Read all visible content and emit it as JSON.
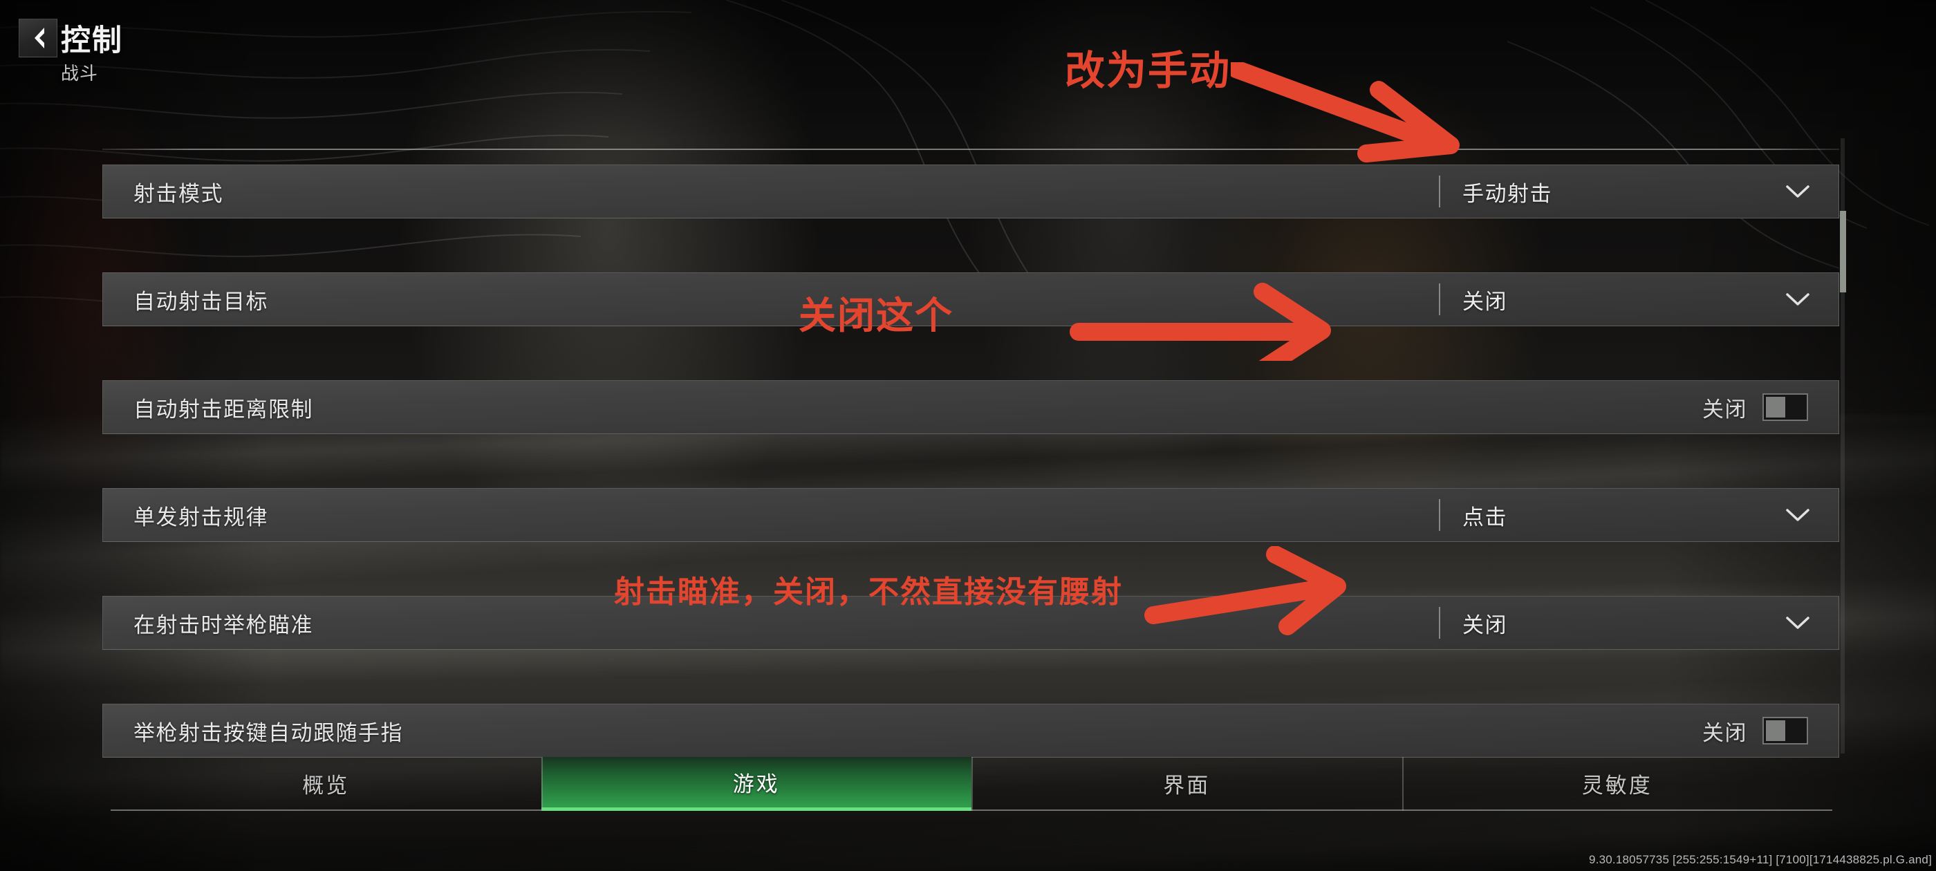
{
  "header": {
    "back_icon": "chevron-left-icon",
    "title": "控制",
    "subtitle": "战斗"
  },
  "settings": {
    "rows": [
      {
        "label": "射击模式",
        "control": "dropdown",
        "value": "手动射击",
        "icon": "chevron-down-icon"
      },
      {
        "label": "自动射击目标",
        "control": "dropdown",
        "value": "关闭",
        "icon": "chevron-down-icon"
      },
      {
        "label": "自动射击距离限制",
        "control": "toggle",
        "value": "关闭",
        "state": "off"
      },
      {
        "label": "单发射击规律",
        "control": "dropdown",
        "value": "点击",
        "icon": "chevron-down-icon"
      },
      {
        "label": "在射击时举枪瞄准",
        "control": "dropdown",
        "value": "关闭",
        "icon": "chevron-down-icon"
      },
      {
        "label": "举枪射击按键自动跟随手指",
        "control": "toggle",
        "value": "关闭",
        "state": "off"
      }
    ]
  },
  "tabs": [
    {
      "label": "概览",
      "active": false
    },
    {
      "label": "游戏",
      "active": true
    },
    {
      "label": "界面",
      "active": false
    },
    {
      "label": "灵敏度",
      "active": false
    }
  ],
  "annotations": [
    {
      "text": "改为手动"
    },
    {
      "text": "关闭这个"
    },
    {
      "text": "射击瞄准，关闭，不然直接没有腰射"
    }
  ],
  "watermark": "9.30.18057735 [255:255:1549+11]  [7100][1714438825.pl.G.and]",
  "colors": {
    "accent_active_tab": "#2f9c4b",
    "accent_tab_underline": "#69e07f",
    "annotation_red": "#e4452f",
    "row_background": "#3a3a3a",
    "toggle_knob": "#7c7f7c"
  }
}
